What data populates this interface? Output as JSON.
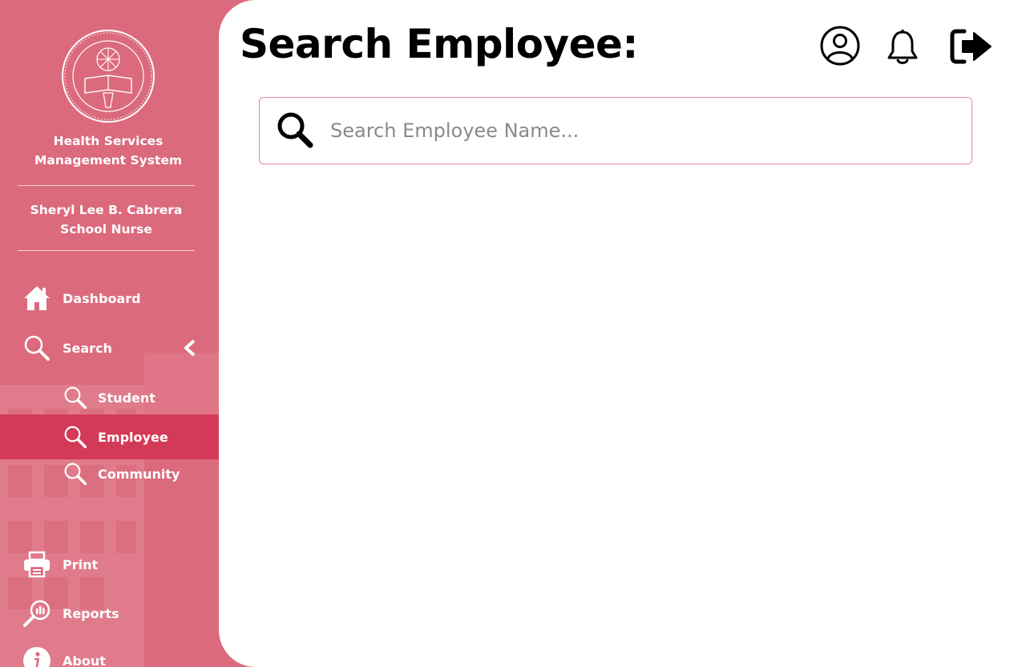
{
  "sidebar": {
    "system_name_line1": "Health Services",
    "system_name_line2": "Management System",
    "user_name": "Sheryl Lee B. Cabrera",
    "user_role": "School Nurse",
    "nav": {
      "dashboard": {
        "label": "Dashboard",
        "icon": "home-icon"
      },
      "search": {
        "label": "Search",
        "icon": "search-icon",
        "expanded": true
      },
      "student": {
        "label": "Student",
        "icon": "search-icon"
      },
      "employee": {
        "label": "Employee",
        "icon": "search-icon",
        "active": true
      },
      "community": {
        "label": "Community",
        "icon": "search-icon"
      },
      "print": {
        "label": "Print",
        "icon": "printer-icon"
      },
      "reports": {
        "label": "Reports",
        "icon": "reports-icon"
      },
      "about": {
        "label": "About",
        "icon": "info-icon"
      }
    }
  },
  "main": {
    "title": "Search Employee:",
    "search": {
      "placeholder": "Search Employee Name...",
      "value": ""
    },
    "header_icons": [
      "user-profile-icon",
      "notification-bell-icon",
      "logout-icon"
    ]
  },
  "colors": {
    "sidebar": "#db6a7c",
    "active_item": "#d33a57",
    "search_border": "#e38a99"
  }
}
